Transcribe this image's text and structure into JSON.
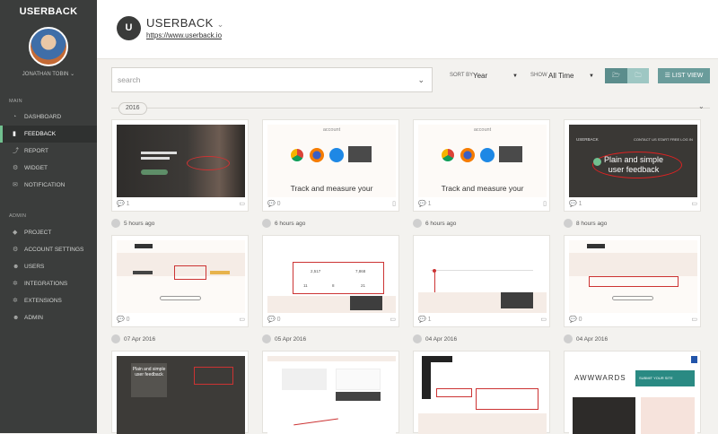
{
  "sidebar": {
    "brand": "USERBACK",
    "username": "JONATHAN TOBIN",
    "main_label": "MAIN",
    "admin_label": "ADMIN",
    "main_items": [
      {
        "label": "DASHBOARD",
        "icon": "dashboard-icon"
      },
      {
        "label": "FEEDBACK",
        "icon": "feedback-icon",
        "active": true
      },
      {
        "label": "REPORT",
        "icon": "report-icon"
      },
      {
        "label": "WIDGET",
        "icon": "widget-icon"
      },
      {
        "label": "NOTIFICATION",
        "icon": "notification-icon"
      }
    ],
    "admin_items": [
      {
        "label": "PROJECT",
        "icon": "tag-icon"
      },
      {
        "label": "ACCOUNT SETTINGS",
        "icon": "gear-icon"
      },
      {
        "label": "USERS",
        "icon": "users-icon"
      },
      {
        "label": "INTEGRATIONS",
        "icon": "integrations-icon"
      },
      {
        "label": "EXTENSIONS",
        "icon": "extensions-icon"
      },
      {
        "label": "ADMIN",
        "icon": "users-icon"
      }
    ]
  },
  "header": {
    "logo_letter": "U",
    "project_name": "USERBACK",
    "project_url": "https://www.userback.io"
  },
  "toolbar": {
    "search_placeholder": "search",
    "sort_label": "SORT BY",
    "sort_value": "Year",
    "show_label": "SHOW",
    "show_value": "All Time",
    "list_view_label": "LIST VIEW"
  },
  "timeline": {
    "year": "2016"
  },
  "cards": [
    {
      "comments": "1",
      "time": "5 hours ago",
      "thumb": "dark"
    },
    {
      "comments": "0",
      "time": "6 hours ago",
      "thumb": "browsers",
      "caption": "Track and measure your",
      "header": "account"
    },
    {
      "comments": "1",
      "time": "6 hours ago",
      "thumb": "browsers",
      "caption": "Track and measure your",
      "header": "account"
    },
    {
      "comments": "1",
      "time": "8 hours ago",
      "thumb": "darkhero",
      "hero_brand": "USERBACK",
      "hero_links": "CONTACT US  START FREE  LOG IN",
      "hero_text": "Plain and simple user feedback"
    },
    {
      "comments": "0",
      "time": "07 Apr 2016",
      "thumb": "cream"
    },
    {
      "comments": "0",
      "time": "05 Apr 2016",
      "thumb": "stats",
      "stats": [
        "2,517",
        "7,868",
        "11",
        "8",
        "21"
      ]
    },
    {
      "comments": "1",
      "time": "04 Apr 2016",
      "thumb": "light"
    },
    {
      "comments": "0",
      "time": "04 Apr 2016",
      "thumb": "cream"
    },
    {
      "comments": "",
      "time": "",
      "thumb": "dark2",
      "hero_text": "Plain and simple user feedback"
    },
    {
      "comments": "",
      "time": "",
      "thumb": "doc"
    },
    {
      "comments": "",
      "time": "",
      "thumb": "doc2"
    },
    {
      "comments": "",
      "time": "",
      "thumb": "awwwards",
      "aw_text": "AWWWARDS",
      "aw_button": "SUBMIT YOUR SITE"
    }
  ],
  "colors": {
    "sidebar": "#3b3d3c",
    "accent": "#71c08f",
    "button": "#5b8d8c"
  }
}
